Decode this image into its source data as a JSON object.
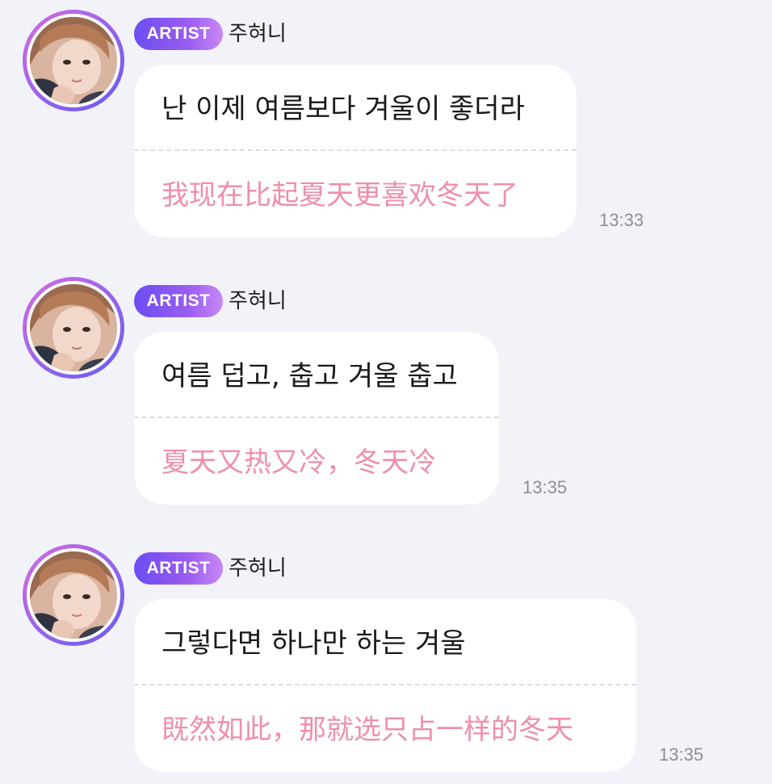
{
  "messages": [
    {
      "badge": "ARTIST",
      "sender": "주혀니",
      "original": "난 이제 여름보다 겨울이 좋더라",
      "translation": "我现在比起夏天更喜欢冬天了",
      "time": "13:33",
      "avatar": "profile-photo"
    },
    {
      "badge": "ARTIST",
      "sender": "주혀니",
      "original": "여름 덥고, 춥고 겨울 춥고",
      "translation": "夏天又热又冷，冬天冷",
      "time": "13:35",
      "avatar": "profile-photo"
    },
    {
      "badge": "ARTIST",
      "sender": "주혀니",
      "original": "그렇다면 하나만 하는 겨울",
      "translation": "既然如此，那就选只占一样的冬天",
      "time": "13:35",
      "avatar": "profile-photo"
    }
  ],
  "colors": {
    "background": "#f1f3f8",
    "bubble": "#ffffff",
    "translation_text": "#ef8fa9",
    "badge_start": "#6c4df2",
    "badge_end": "#c888f5",
    "timestamp": "#8c8f96"
  }
}
